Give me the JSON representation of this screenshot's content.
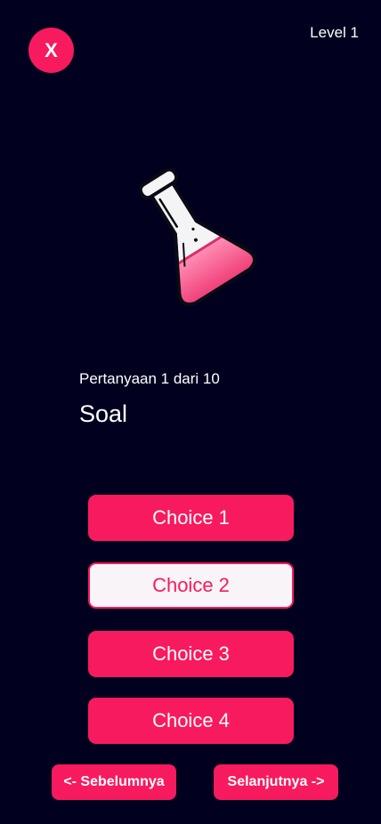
{
  "header": {
    "close_label": "X",
    "level_label": "Level 1"
  },
  "illustration": {
    "icon": "flask-icon"
  },
  "question": {
    "counter": "Pertanyaan 1 dari 10",
    "text": "Soal"
  },
  "choices": [
    {
      "label": "Choice 1",
      "selected": false
    },
    {
      "label": "Choice 2",
      "selected": true
    },
    {
      "label": "Choice 3",
      "selected": false
    },
    {
      "label": "Choice 4",
      "selected": false
    }
  ],
  "navigation": {
    "prev_label": "<- Sebelumnya",
    "next_label": "Selanjutnya ->"
  },
  "colors": {
    "background": "#01011f",
    "accent": "#f81a5e",
    "selected_bg": "#f8f4f8"
  }
}
